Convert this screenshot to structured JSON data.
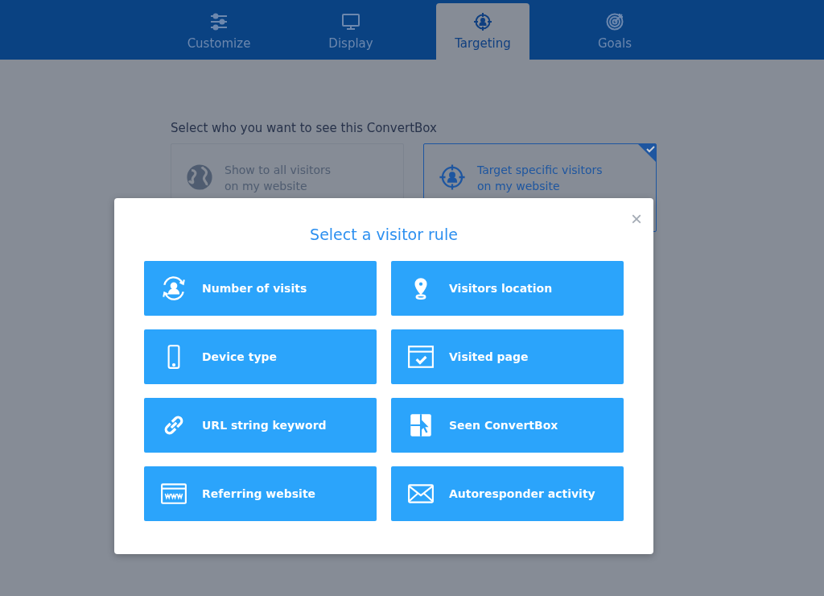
{
  "tabs": [
    {
      "label": "Customize",
      "kind": "sliders",
      "selected": false
    },
    {
      "label": "Display",
      "kind": "monitor",
      "selected": false
    },
    {
      "label": "Targeting",
      "kind": "target",
      "selected": true
    },
    {
      "label": "Goals",
      "kind": "goal",
      "selected": false
    }
  ],
  "heading": "Select who you want to see this ConvertBox",
  "options": [
    {
      "line1": "Show to all visitors",
      "line2": "on my website",
      "kind": "globe",
      "selected": false
    },
    {
      "line1": "Target specific visitors",
      "line2": "on my website",
      "kind": "target",
      "selected": true
    }
  ],
  "modal": {
    "title": "Select a visitor rule",
    "close": "×",
    "rules": [
      {
        "label": "Number of visits",
        "kind": "visits"
      },
      {
        "label": "Visitors location",
        "kind": "pin"
      },
      {
        "label": "Device type",
        "kind": "phone"
      },
      {
        "label": "Visited page",
        "kind": "page"
      },
      {
        "label": "URL string keyword",
        "kind": "link"
      },
      {
        "label": "Seen ConvertBox",
        "kind": "box"
      },
      {
        "label": "Referring website",
        "kind": "www"
      },
      {
        "label": "Autoresponder activity",
        "kind": "mail"
      }
    ]
  }
}
